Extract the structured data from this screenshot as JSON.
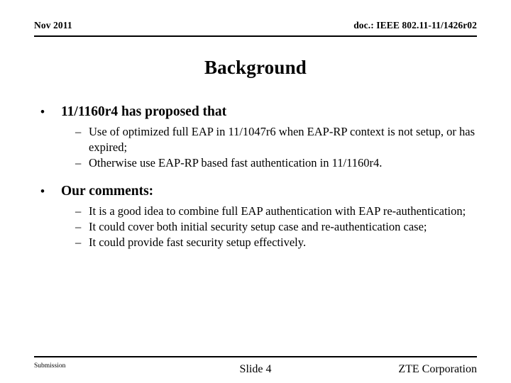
{
  "header": {
    "date": "Nov 2011",
    "doc": "doc.: IEEE 802.11-11/1426r02"
  },
  "title": "Background",
  "content": {
    "blocks": [
      {
        "marker": "•",
        "text": "11/1160r4 has proposed that",
        "sub": [
          {
            "marker": "–",
            "text": "Use of optimized full EAP in 11/1047r6 when EAP-RP context is not setup, or has expired;"
          },
          {
            "marker": "–",
            "text": "Otherwise use EAP-RP based fast authentication in 11/1160r4."
          }
        ]
      },
      {
        "marker": "•",
        "text": "Our comments:",
        "sub": [
          {
            "marker": "–",
            "text": "It is a good idea to combine full EAP authentication with EAP re-authentication;"
          },
          {
            "marker": "–",
            "text": "It could cover both initial security setup case and re-authentication case;"
          },
          {
            "marker": "–",
            "text": "It could provide fast security setup effectively."
          }
        ]
      }
    ]
  },
  "footer": {
    "left": "Submission",
    "center": "Slide 4",
    "right": "ZTE Corporation"
  }
}
